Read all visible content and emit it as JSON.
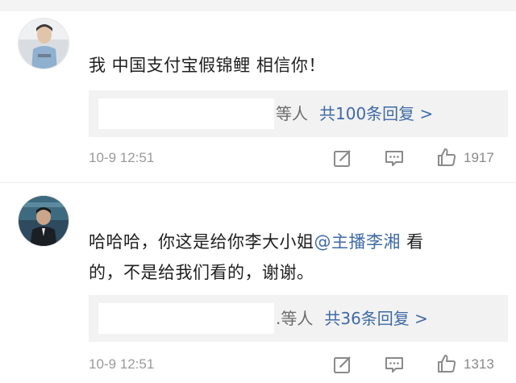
{
  "comments": [
    {
      "text_lines": [
        "我 中国支付宝假锦鲤 相信你！"
      ],
      "reply_summary": {
        "users_suffix": "等人",
        "count_label": "共100条回复 >"
      },
      "timestamp": "10-9 12:51",
      "likes": "1917",
      "icons": [
        "edit-icon",
        "comment-icon",
        "thumbs-up-icon"
      ]
    },
    {
      "text_lines": [
        "哈哈哈，你这是给你李大小姐",
        "的，不是给我们看的，谢谢。"
      ],
      "mention": "@主播李湘",
      "after_mention": " 看",
      "reply_summary": {
        "users_suffix": ".等人",
        "count_label": "共36条回复 >"
      },
      "timestamp": "10-9 12:51",
      "likes": "1313",
      "icons": [
        "edit-icon",
        "comment-icon",
        "thumbs-up-icon"
      ]
    }
  ],
  "colors": {
    "link": "#3f6aa5",
    "meta": "#9a9a9a",
    "reply_bg": "#f2f2f2"
  }
}
